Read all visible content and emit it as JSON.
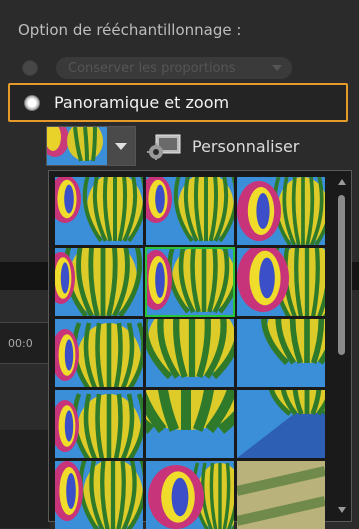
{
  "header": {
    "label": "Option de rééchantillonnage :"
  },
  "options": {
    "disabled": {
      "label": "Conserver les proportions"
    },
    "selected": {
      "label": "Panoramique et zoom"
    }
  },
  "toolbar": {
    "customize_label": "Personnaliser"
  },
  "timeline": {
    "timecode": "00:0"
  },
  "gallery": {
    "selected_index": 4,
    "items": [
      {
        "variant": "a"
      },
      {
        "variant": "a"
      },
      {
        "variant": "b"
      },
      {
        "variant": "c"
      },
      {
        "variant": "d"
      },
      {
        "variant": "e"
      },
      {
        "variant": "f"
      },
      {
        "variant": "g"
      },
      {
        "variant": "h"
      },
      {
        "variant": "f"
      },
      {
        "variant": "i"
      },
      {
        "variant": "j"
      },
      {
        "variant": "k"
      },
      {
        "variant": "l"
      },
      {
        "variant": "m"
      }
    ]
  },
  "colors": {
    "accent": "#e59a2a",
    "selection": "#28c43a",
    "sky": "#3a8fd8"
  }
}
